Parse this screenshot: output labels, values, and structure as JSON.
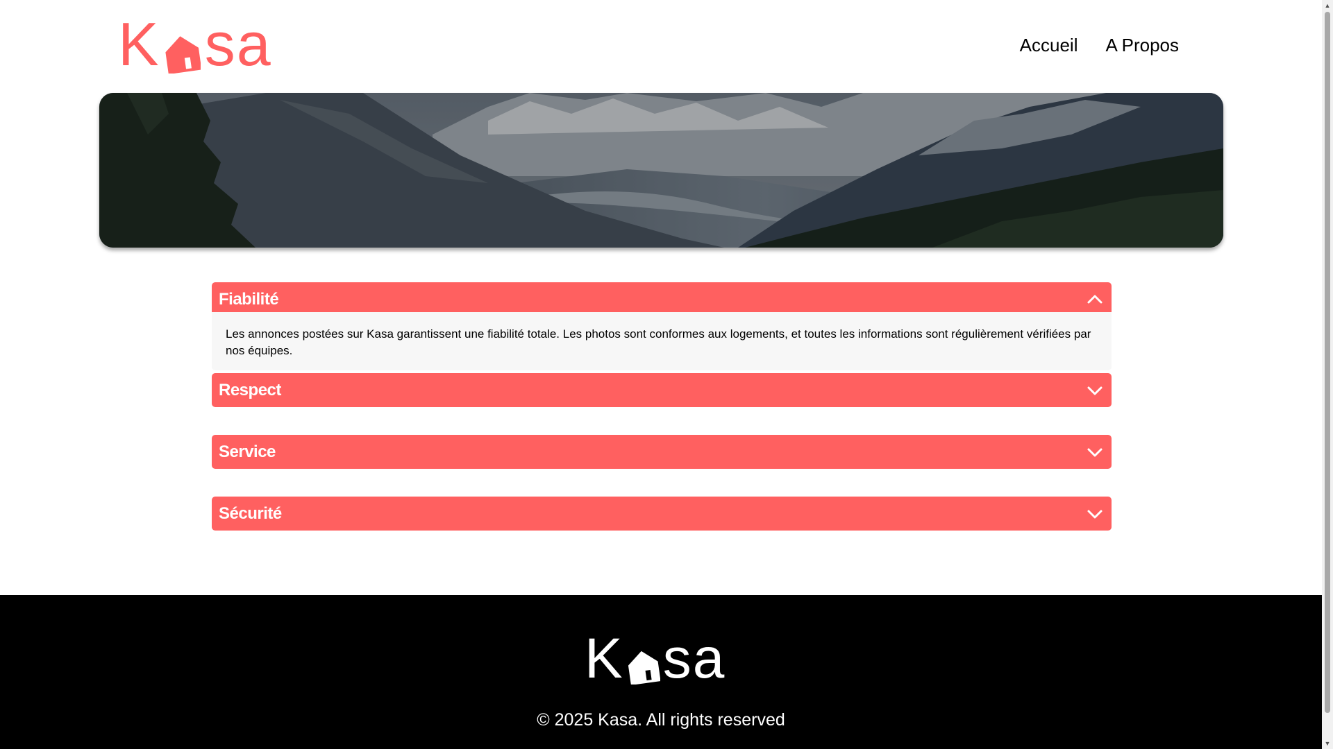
{
  "header": {
    "logo_text_left": "K",
    "logo_text_right": "sa",
    "nav": [
      {
        "label": "Accueil"
      },
      {
        "label": "A Propos"
      }
    ]
  },
  "colors": {
    "accent": "#FF6060",
    "collapse_body_bg": "#F7F7F7",
    "footer_bg": "#000000"
  },
  "collapses": [
    {
      "title": "Fiabilité",
      "open": true,
      "icon": "chevron-up-icon",
      "text": "Les annonces postées sur Kasa garantissent une fiabilité totale. Les photos sont conformes aux logements, et toutes les informations sont régulièrement vérifiées par nos équipes."
    },
    {
      "title": "Respect",
      "open": false,
      "icon": "chevron-down-icon"
    },
    {
      "title": "Service",
      "open": false,
      "icon": "chevron-down-icon"
    },
    {
      "title": "Sécurité",
      "open": false,
      "icon": "chevron-down-icon"
    }
  ],
  "footer": {
    "logo_text_left": "K",
    "logo_text_right": "sa",
    "copyright": "© 2025 Kasa. All rights reserved"
  }
}
